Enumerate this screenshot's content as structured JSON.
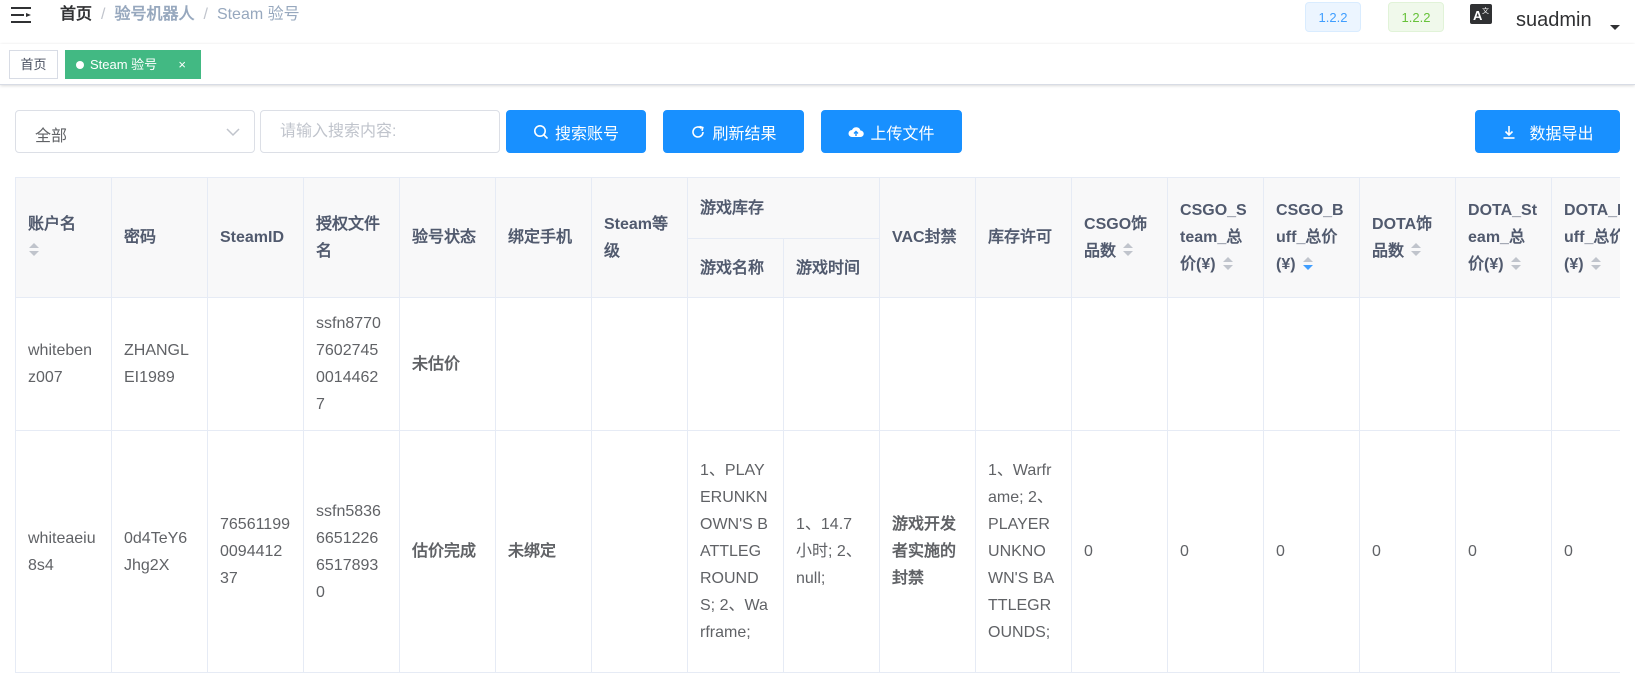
{
  "navbar": {
    "breadcrumb": {
      "home": "首页",
      "middle": "验号机器人",
      "current": "Steam 验号",
      "separator": "/"
    },
    "version_badges": [
      "1.2.2",
      "1.2.2"
    ],
    "username": "suadmin"
  },
  "tags": {
    "home": "首页",
    "active": "Steam 验号",
    "close": "×"
  },
  "toolbar": {
    "filter_select": {
      "value": "全部"
    },
    "search": {
      "placeholder": "请输入搜索内容:"
    },
    "buttons": {
      "search": "搜索账号",
      "refresh": "刷新结果",
      "upload": "上传文件",
      "export": "数据导出"
    }
  },
  "table": {
    "headers": {
      "account": "账户名",
      "password": "密码",
      "steamid": "SteamID",
      "auth_file": "授权文件名",
      "status": "验号状态",
      "phone": "绑定手机",
      "level": "Steam等级",
      "library_group": "游戏库存",
      "game_name": "游戏名称",
      "game_time": "游戏时间",
      "vac": "VAC封禁",
      "license": "库存许可",
      "csgo_count": "CSGO饰品数",
      "csgo_steam_total": "CSGO_Steam_总价(¥)",
      "csgo_buff_total": "CSGO_Buff_总价(¥)",
      "dota_count": "DOTA饰品数",
      "dota_steam_total": "DOTA_Steam_总价(¥)",
      "dota_buff_total": "DOTA_Buff_总价(¥)"
    },
    "rows": [
      {
        "account": "whitebenz007",
        "password": "ZHANGLEI1989",
        "steamid": "",
        "auth_file": "ssfn877076027450014462 7",
        "status": "未估价",
        "phone": "",
        "level": "",
        "game_name": "",
        "game_time": "",
        "vac": "",
        "license": "",
        "csgo_count": "",
        "csgo_steam_total": "",
        "csgo_buff_total": "",
        "dota_count": "",
        "dota_steam_total": "",
        "dota_buff_total": ""
      },
      {
        "account": "whiteaeiu8s4",
        "password": "0d4TeY6Jhg2X",
        "steamid": "76561199009441237",
        "auth_file": "ssfn5836665122665178930",
        "status": "估价完成",
        "phone": "未绑定",
        "level": "",
        "game_name": "1、PLAYERUNKNOWN'S BATTLEGROUNDS; 2、Warframe;",
        "game_time": "1、14.7小时; 2、null;",
        "vac": "游戏开发者实施的封禁",
        "license": "1、Warframe; 2、PLAYERUNKNOWN'S BATTLEGROUNDS;",
        "csgo_count": "0",
        "csgo_steam_total": "0",
        "csgo_buff_total": "0",
        "dota_count": "0",
        "dota_steam_total": "0",
        "dota_buff_total": "0"
      }
    ],
    "sort_state": {
      "csgo_buff_total": "descending"
    }
  },
  "icons": [
    "hamburger-icon",
    "translate-icon",
    "search-icon",
    "refresh-icon",
    "cloud-upload-icon",
    "download-icon",
    "chevron-down-icon",
    "sort-icon"
  ],
  "colors": {
    "primary": "#1890ff",
    "active_tag": "#42b983",
    "badge_blue": "#409eff",
    "badge_green": "#67c23a"
  }
}
